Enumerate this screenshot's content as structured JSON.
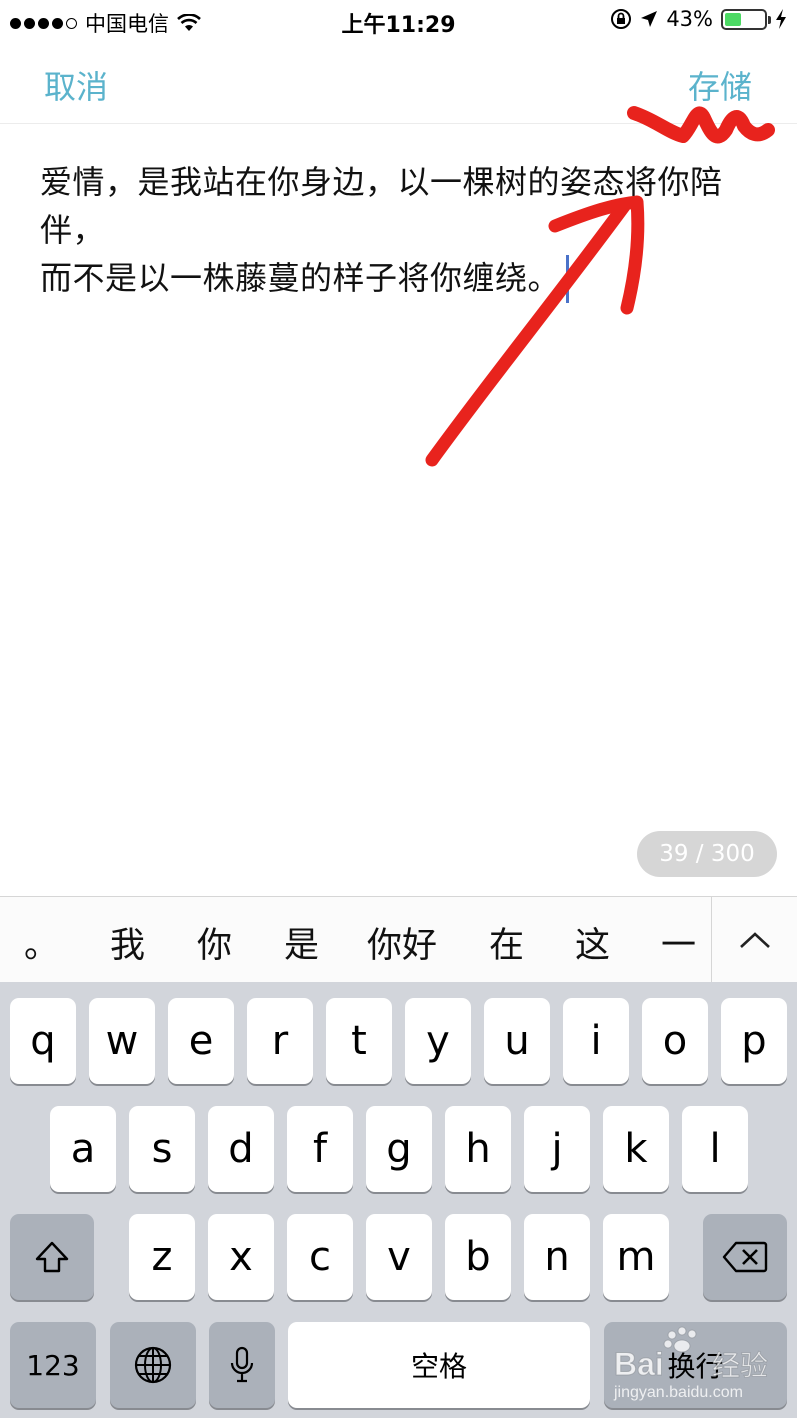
{
  "status_bar": {
    "carrier": "中国电信",
    "time": "上午11:29",
    "battery_percent": "43%",
    "battery_level": 0.43
  },
  "nav": {
    "cancel_label": "取消",
    "save_label": "存储"
  },
  "editor": {
    "line1": "爱情，是我站在你身边，以一棵树的姿态将你陪伴，",
    "line2": "而不是以一株藤蔓的样子将你缠绕。"
  },
  "counter": "39 / 300",
  "candidates": [
    "。",
    "我",
    "你",
    "是",
    "你好",
    "在",
    "这",
    "一"
  ],
  "keyboard": {
    "row1": [
      "q",
      "w",
      "e",
      "r",
      "t",
      "y",
      "u",
      "i",
      "o",
      "p"
    ],
    "row2": [
      "a",
      "s",
      "d",
      "f",
      "g",
      "h",
      "j",
      "k",
      "l"
    ],
    "row3": [
      "z",
      "x",
      "c",
      "v",
      "b",
      "n",
      "m"
    ],
    "numbers_label": "123",
    "space_label": "空格",
    "return_label": "换行"
  },
  "watermark": {
    "brand": "Bai",
    "suffix": "经验",
    "url": "jingyan.baidu.com"
  },
  "colors": {
    "accent": "#5bb3cc",
    "annotation": "#e8231d",
    "caret": "#4a72c9",
    "battery": "#4cd964"
  }
}
